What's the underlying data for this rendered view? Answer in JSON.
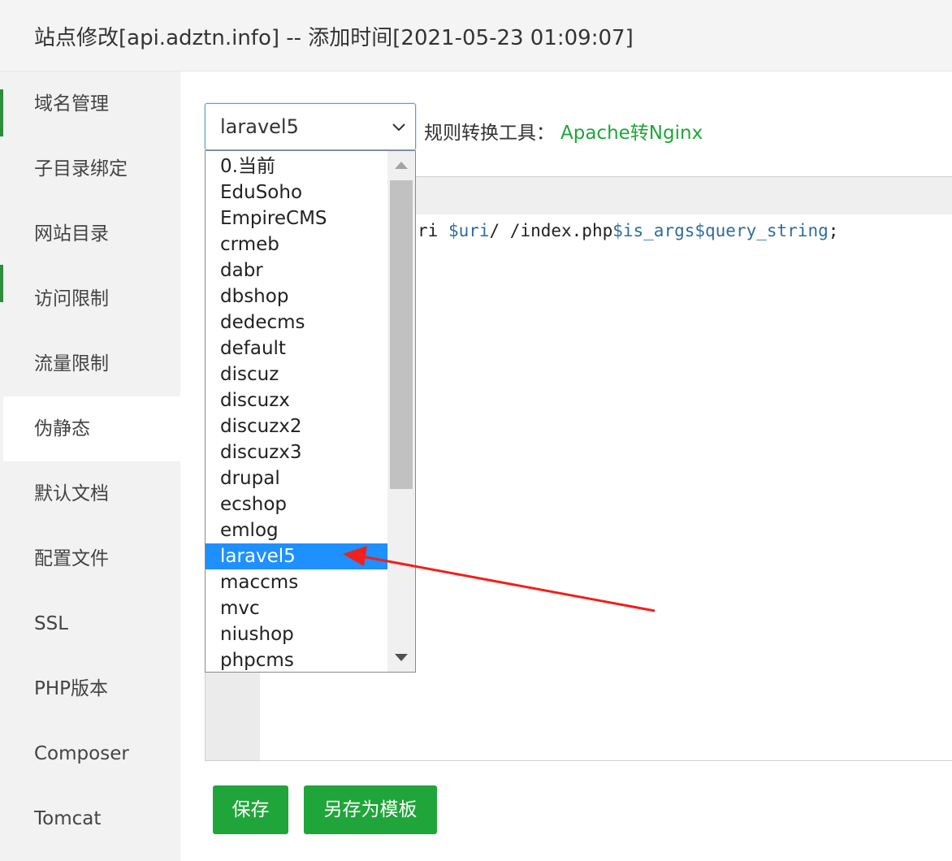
{
  "window": {
    "title": "站点修改[api.adztn.info] -- 添加时间[2021-05-23 01:09:07]"
  },
  "sidebar": {
    "items": [
      {
        "label": "域名管理"
      },
      {
        "label": "子目录绑定"
      },
      {
        "label": "网站目录"
      },
      {
        "label": "访问限制"
      },
      {
        "label": "流量限制"
      },
      {
        "label": "伪静态",
        "active": true
      },
      {
        "label": "默认文档"
      },
      {
        "label": "配置文件"
      },
      {
        "label": "SSL"
      },
      {
        "label": "PHP版本"
      },
      {
        "label": "Composer"
      },
      {
        "label": "Tomcat"
      }
    ]
  },
  "rewrite": {
    "selected": "laravel5",
    "tool_label": "规则转换工具：",
    "tool_link": "Apache转Nginx",
    "options": [
      "0.当前",
      "EduSoho",
      "EmpireCMS",
      "crmeb",
      "dabr",
      "dbshop",
      "dedecms",
      "default",
      "discuz",
      "discuzx",
      "discuzx2",
      "discuzx3",
      "drupal",
      "ecshop",
      "emlog",
      "laravel5",
      "maccms",
      "mvc",
      "niushop",
      "phpcms"
    ],
    "selected_index": 15
  },
  "editor": {
    "code_prefix": "ri ",
    "code_var1": "$uri",
    "code_mid": "/ /index.php",
    "code_var2": "$is_args$query_string",
    "code_suffix": ";"
  },
  "buttons": {
    "save": "保存",
    "save_as_template": "另存为模板"
  },
  "colors": {
    "accent_green": "#20a53a",
    "selection_blue": "#1e90ff",
    "arrow_red": "#f0201c"
  }
}
